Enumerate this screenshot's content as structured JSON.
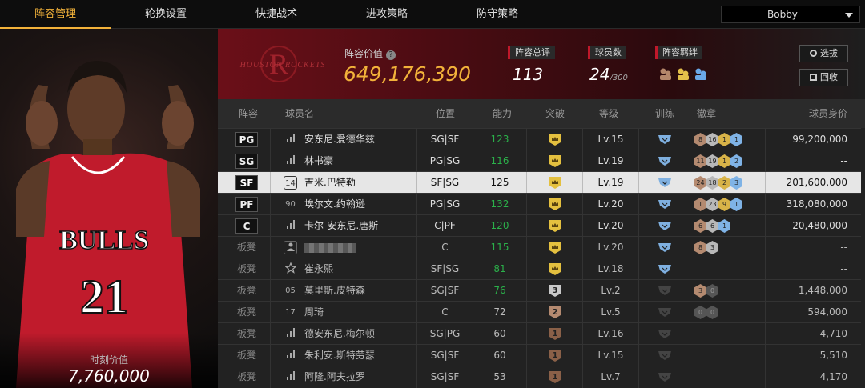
{
  "nav": {
    "tabs": [
      {
        "label": "阵容管理",
        "active": true
      },
      {
        "label": "轮换设置",
        "active": false
      },
      {
        "label": "快捷战术",
        "active": false
      },
      {
        "label": "进攻策略",
        "active": false
      },
      {
        "label": "防守策略",
        "active": false
      }
    ],
    "user": "Bobby"
  },
  "player_card": {
    "jersey_team": "BULLS",
    "jersey_number": "21",
    "moment_label": "时刻价值",
    "moment_value": "7,760,000"
  },
  "header": {
    "team_logo_text": "HOUSTON ROCKETS",
    "lineup_value_label": "阵容价值",
    "lineup_value": "649,176,390",
    "stats": [
      {
        "label": "阵容总评",
        "value": "113",
        "suffix": ""
      },
      {
        "label": "球员数",
        "value": "24",
        "suffix": "/300"
      },
      {
        "label": "阵容羁绊",
        "value": "",
        "suffix": ""
      }
    ],
    "buttons": [
      {
        "label": "选拔",
        "icon": "refresh-icon"
      },
      {
        "label": "回收",
        "icon": "recycle-bin-icon"
      }
    ]
  },
  "table": {
    "columns": [
      "阵容",
      "球员名",
      "位置",
      "能力",
      "突破",
      "等级",
      "训练",
      "徽章",
      "球员身价"
    ],
    "rows": [
      {
        "slot": "PG",
        "bench": false,
        "icon_type": "bars",
        "icon_text": "",
        "name": "安东尼.爱德华兹",
        "position": "SG|SF",
        "ability": "123",
        "ability_green": true,
        "breakthrough": "crown",
        "level": "Lv.15",
        "training": "active",
        "badges": [
          {
            "t": "bronze",
            "v": "8"
          },
          {
            "t": "silver",
            "v": "16"
          },
          {
            "t": "gold",
            "v": "1"
          },
          {
            "t": "blue",
            "v": "1"
          }
        ],
        "value": "99,200,000",
        "selected": false
      },
      {
        "slot": "SG",
        "bench": false,
        "icon_type": "bars",
        "icon_text": "",
        "name": "林书豪",
        "position": "PG|SG",
        "ability": "116",
        "ability_green": true,
        "breakthrough": "crown",
        "level": "Lv.19",
        "training": "active",
        "badges": [
          {
            "t": "bronze",
            "v": "11"
          },
          {
            "t": "silver",
            "v": "19"
          },
          {
            "t": "gold",
            "v": "1"
          },
          {
            "t": "blue",
            "v": "2"
          }
        ],
        "value": "-- ",
        "selected": false
      },
      {
        "slot": "SF",
        "bench": false,
        "icon_type": "num",
        "icon_text": "14",
        "name": "吉米.巴特勒",
        "position": "SF|SG",
        "ability": "125",
        "ability_green": false,
        "breakthrough": "crown",
        "level": "Lv.19",
        "training": "active",
        "badges": [
          {
            "t": "bronze",
            "v": "24"
          },
          {
            "t": "silver",
            "v": "18"
          },
          {
            "t": "gold",
            "v": "2"
          },
          {
            "t": "blue",
            "v": "3"
          }
        ],
        "value": "201,600,000",
        "selected": true
      },
      {
        "slot": "PF",
        "bench": false,
        "icon_type": "text",
        "icon_text": "90",
        "name": "埃尔文.约翰逊",
        "position": "PG|SG",
        "ability": "132",
        "ability_green": true,
        "breakthrough": "crown",
        "level": "Lv.20",
        "training": "active",
        "badges": [
          {
            "t": "bronze",
            "v": "1"
          },
          {
            "t": "silver",
            "v": "23"
          },
          {
            "t": "gold",
            "v": "9"
          },
          {
            "t": "blue",
            "v": "1"
          }
        ],
        "value": "318,080,000",
        "selected": false
      },
      {
        "slot": "C",
        "bench": false,
        "icon_type": "bars",
        "icon_text": "",
        "name": "卡尔-安东尼.唐斯",
        "position": "C|PF",
        "ability": "120",
        "ability_green": true,
        "breakthrough": "crown",
        "level": "Lv.20",
        "training": "active",
        "badges": [
          {
            "t": "bronze",
            "v": "6"
          },
          {
            "t": "silver",
            "v": "6"
          },
          {
            "t": "blue",
            "v": "1"
          }
        ],
        "value": "20,480,000",
        "selected": false
      },
      {
        "slot": "板凳",
        "bench": true,
        "icon_type": "person",
        "icon_text": "",
        "name": "",
        "position": "C",
        "ability": "115",
        "ability_green": true,
        "breakthrough": "crown",
        "level": "Lv.20",
        "training": "active",
        "badges": [
          {
            "t": "bronze",
            "v": "8"
          },
          {
            "t": "silver",
            "v": "3"
          }
        ],
        "value": "--",
        "selected": false
      },
      {
        "slot": "板凳",
        "bench": true,
        "icon_type": "star",
        "icon_text": "",
        "name": "崔永熙",
        "position": "SF|SG",
        "ability": "81",
        "ability_green": true,
        "breakthrough": "crown",
        "level": "Lv.18",
        "training": "active",
        "badges": [],
        "value": "--",
        "selected": false
      },
      {
        "slot": "板凳",
        "bench": true,
        "icon_type": "text",
        "icon_text": "05",
        "name": "莫里斯.皮特森",
        "position": "SG|SF",
        "ability": "76",
        "ability_green": true,
        "breakthrough": "3",
        "level": "Lv.2",
        "training": "inactive",
        "badges": [
          {
            "t": "bronze",
            "v": "3"
          },
          {
            "t": "dark",
            "v": "0"
          }
        ],
        "value": "1,448,000",
        "selected": false
      },
      {
        "slot": "板凳",
        "bench": true,
        "icon_type": "text",
        "icon_text": "17",
        "name": "周琦",
        "position": "C",
        "ability": "72",
        "ability_green": false,
        "breakthrough": "2",
        "level": "Lv.5",
        "training": "inactive",
        "badges": [
          {
            "t": "dark",
            "v": "0"
          },
          {
            "t": "dark",
            "v": "0"
          }
        ],
        "value": "594,000",
        "selected": false
      },
      {
        "slot": "板凳",
        "bench": true,
        "icon_type": "bars",
        "icon_text": "",
        "name": "德安东尼.梅尔顿",
        "position": "SG|PG",
        "ability": "60",
        "ability_green": false,
        "breakthrough": "1",
        "level": "Lv.16",
        "training": "inactive",
        "badges": [],
        "value": "4,710",
        "selected": false
      },
      {
        "slot": "板凳",
        "bench": true,
        "icon_type": "bars",
        "icon_text": "",
        "name": "朱利安.斯特劳瑟",
        "position": "SG|SF",
        "ability": "60",
        "ability_green": false,
        "breakthrough": "1",
        "level": "Lv.15",
        "training": "inactive",
        "badges": [],
        "value": "5,510",
        "selected": false
      },
      {
        "slot": "板凳",
        "bench": true,
        "icon_type": "bars",
        "icon_text": "",
        "name": "阿隆.阿夫拉罗",
        "position": "SG|SF",
        "ability": "53",
        "ability_green": false,
        "breakthrough": "1",
        "level": "Lv.7",
        "training": "inactive",
        "badges": [],
        "value": "4,170",
        "selected": false
      }
    ]
  },
  "colors": {
    "accent": "#f2b23a",
    "team_red": "#c0182a",
    "ability_green": "#2bb14a"
  }
}
